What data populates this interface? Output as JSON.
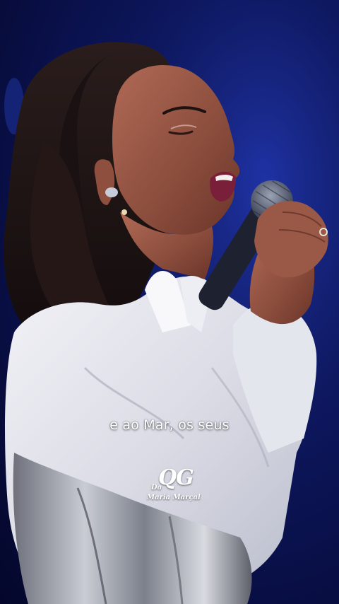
{
  "video": {
    "subtitle": "e ao Mar, os seus",
    "scene": "singer-performing"
  },
  "watermark": {
    "prefix": "Da",
    "mark": "QG",
    "name": "Maria Marçal"
  },
  "colors": {
    "background": "#0d1760",
    "subtitle_text": "#ffffff"
  }
}
